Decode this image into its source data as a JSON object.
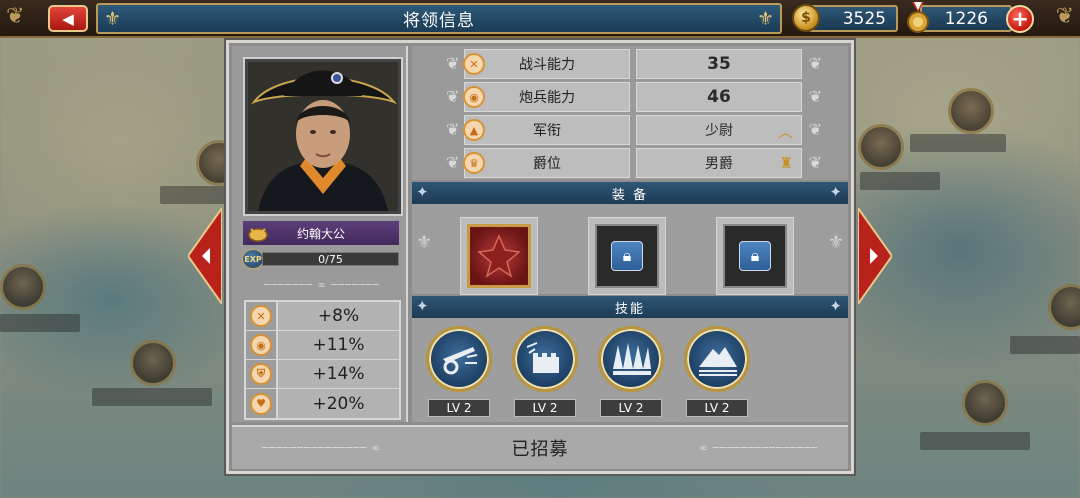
{
  "header": {
    "title": "将领信息"
  },
  "resources": {
    "gold": "3525",
    "medals": "1226"
  },
  "general": {
    "name": "约翰大公",
    "exp": "0/75"
  },
  "bonuses": [
    {
      "icon": "crossed-swords-icon",
      "value": "+8%"
    },
    {
      "icon": "cannon-icon",
      "value": "+11%"
    },
    {
      "icon": "shield-icon",
      "value": "+14%"
    },
    {
      "icon": "heart-icon",
      "value": "+20%"
    }
  ],
  "stats": [
    {
      "label": "战斗能力",
      "value": "35"
    },
    {
      "label": "炮兵能力",
      "value": "46"
    },
    {
      "label": "军衔",
      "value": "少尉"
    },
    {
      "label": "爵位",
      "value": "男爵"
    }
  ],
  "equipment": {
    "title": "装 备"
  },
  "skills": {
    "title": "技能",
    "items": [
      {
        "icon": "artillery-skill-icon",
        "level": "LV 2"
      },
      {
        "icon": "fortress-skill-icon",
        "level": "LV 2"
      },
      {
        "icon": "spikes-skill-icon",
        "level": "LV 2"
      },
      {
        "icon": "mountain-skill-icon",
        "level": "LV 2"
      }
    ]
  },
  "footer": {
    "status": "已招募"
  },
  "colors": {
    "header_blue": "#1d3b55",
    "panel_gray": "#8d8d8d",
    "name_purple": "#5d3f7a",
    "gold": "#c89020"
  }
}
